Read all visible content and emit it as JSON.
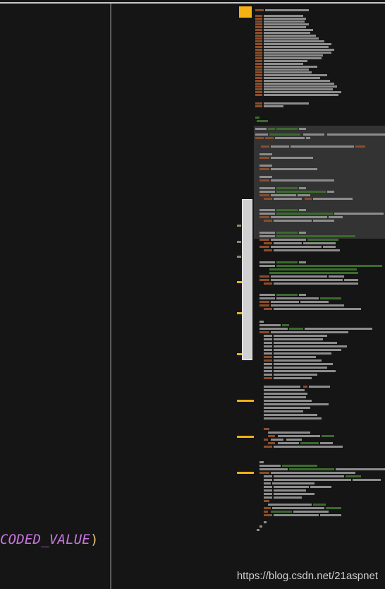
{
  "editor": {
    "code_fragment": "CODED_VALUE",
    "close_paren": ")"
  },
  "overview_markers": [
    {
      "color": "#8c8a6a"
    },
    {
      "color": "#8c8a6a"
    },
    {
      "color": "#8c8a6a"
    },
    {
      "color": "#f5b013"
    },
    {
      "color": "#f5b013"
    },
    {
      "color": "#f5b013"
    },
    {
      "color": "#f5b013"
    },
    {
      "color": "#f5b013"
    },
    {
      "color": "#f5b013"
    }
  ],
  "colors": {
    "keyword": "#8a4e2b",
    "text": "#8d8d8d",
    "string": "#3b6b2e",
    "accent": "#f5b013"
  },
  "watermark": "https://blog.csdn.net/21aspnet"
}
